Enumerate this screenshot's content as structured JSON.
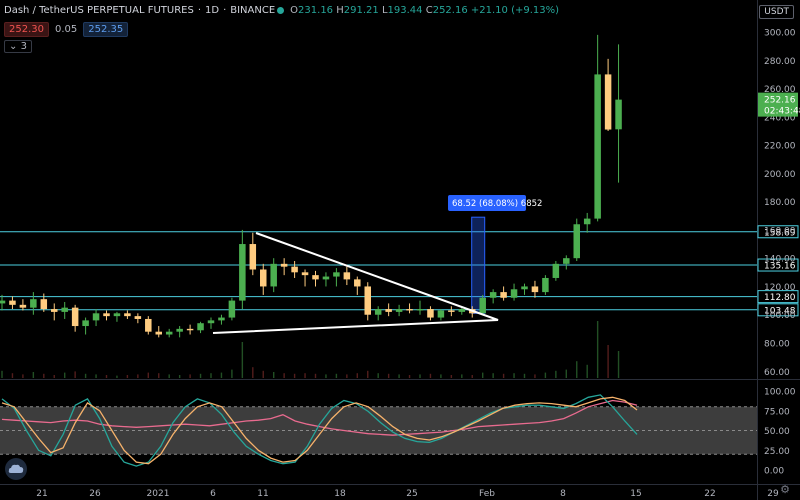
{
  "header": {
    "symbol": "Dash / TetherUS PERPETUAL FUTURES",
    "interval": "1D",
    "exchange": "BINANCE",
    "ohlc": {
      "open_label": "O",
      "open": "231.16",
      "high_label": "H",
      "high": "291.21",
      "low_label": "L",
      "low": "193.44",
      "close_label": "C",
      "close": "252.16",
      "change": "+21.10 (+9.13%)"
    },
    "sell_price": "252.30",
    "spread": "0.05",
    "buy_price": "252.35",
    "indicators_toggle": "3",
    "currency_button": "USDT"
  },
  "colors": {
    "up": "#26a69a",
    "down": "#ef5350",
    "candle_up_body": "#4caf50",
    "candle_down_body": "#ffcc80",
    "hline": "#4dd0e1",
    "triangle": "#ffffff",
    "range_box": "#2962ff",
    "stoch_k": "#f6b26b",
    "stoch_d": "#26a69a",
    "rsi": "#e96b8f"
  },
  "price_axis": {
    "ticks": [
      "300.00",
      "280.00",
      "260.00",
      "240.00",
      "220.00",
      "200.00",
      "180.00",
      "160.00",
      "140.00",
      "120.00",
      "100.00",
      "80.00",
      "60.00"
    ],
    "last_price_label": "252.16",
    "countdown_label": "02:43:48"
  },
  "time_axis": {
    "ticks": [
      "21",
      "26",
      "2021",
      "6",
      "11",
      "18",
      "25",
      "Feb",
      "8",
      "15",
      "22",
      "29"
    ]
  },
  "horizontal_levels": [
    "158.69",
    "135.16",
    "112.80",
    "103.48"
  ],
  "measure_tool": {
    "label": "68.52 (68.08%) 6852"
  },
  "oscillator_axis": {
    "ticks": [
      "100.00",
      "75.00",
      "50.00",
      "25.00",
      "0.00"
    ]
  },
  "chart_data": {
    "type": "candlestick",
    "date_ticks": [
      "21",
      "26",
      "2021",
      "6",
      "11",
      "18",
      "25",
      "Feb",
      "8",
      "15",
      "22",
      "29"
    ],
    "y_range": [
      60,
      305
    ],
    "candles": [
      {
        "o": 108,
        "h": 114,
        "l": 103,
        "c": 110
      },
      {
        "o": 110,
        "h": 113,
        "l": 104,
        "c": 107
      },
      {
        "o": 107,
        "h": 111,
        "l": 103,
        "c": 105
      },
      {
        "o": 105,
        "h": 116,
        "l": 100,
        "c": 111
      },
      {
        "o": 111,
        "h": 115,
        "l": 102,
        "c": 104
      },
      {
        "o": 104,
        "h": 108,
        "l": 96,
        "c": 102
      },
      {
        "o": 102,
        "h": 109,
        "l": 97,
        "c": 105
      },
      {
        "o": 105,
        "h": 107,
        "l": 88,
        "c": 92
      },
      {
        "o": 92,
        "h": 98,
        "l": 86,
        "c": 96
      },
      {
        "o": 96,
        "h": 104,
        "l": 92,
        "c": 101
      },
      {
        "o": 101,
        "h": 103,
        "l": 96,
        "c": 99
      },
      {
        "o": 99,
        "h": 102,
        "l": 95,
        "c": 101
      },
      {
        "o": 101,
        "h": 103,
        "l": 97,
        "c": 99
      },
      {
        "o": 99,
        "h": 101,
        "l": 94,
        "c": 97
      },
      {
        "o": 97,
        "h": 99,
        "l": 86,
        "c": 88
      },
      {
        "o": 88,
        "h": 92,
        "l": 84,
        "c": 86
      },
      {
        "o": 86,
        "h": 90,
        "l": 84,
        "c": 88
      },
      {
        "o": 88,
        "h": 92,
        "l": 84,
        "c": 90
      },
      {
        "o": 90,
        "h": 93,
        "l": 86,
        "c": 89
      },
      {
        "o": 89,
        "h": 95,
        "l": 87,
        "c": 94
      },
      {
        "o": 94,
        "h": 98,
        "l": 90,
        "c": 96
      },
      {
        "o": 96,
        "h": 100,
        "l": 93,
        "c": 98
      },
      {
        "o": 98,
        "h": 112,
        "l": 96,
        "c": 110
      },
      {
        "o": 110,
        "h": 160,
        "l": 104,
        "c": 150
      },
      {
        "o": 150,
        "h": 158,
        "l": 128,
        "c": 132
      },
      {
        "o": 132,
        "h": 136,
        "l": 114,
        "c": 120
      },
      {
        "o": 120,
        "h": 140,
        "l": 116,
        "c": 136
      },
      {
        "o": 136,
        "h": 140,
        "l": 128,
        "c": 134
      },
      {
        "o": 134,
        "h": 138,
        "l": 126,
        "c": 130
      },
      {
        "o": 130,
        "h": 132,
        "l": 120,
        "c": 128
      },
      {
        "o": 128,
        "h": 131,
        "l": 120,
        "c": 125
      },
      {
        "o": 125,
        "h": 130,
        "l": 120,
        "c": 127
      },
      {
        "o": 127,
        "h": 133,
        "l": 120,
        "c": 130
      },
      {
        "o": 130,
        "h": 134,
        "l": 121,
        "c": 125
      },
      {
        "o": 125,
        "h": 127,
        "l": 114,
        "c": 120
      },
      {
        "o": 120,
        "h": 123,
        "l": 96,
        "c": 100
      },
      {
        "o": 100,
        "h": 106,
        "l": 96,
        "c": 104
      },
      {
        "o": 104,
        "h": 108,
        "l": 99,
        "c": 102
      },
      {
        "o": 102,
        "h": 107,
        "l": 99,
        "c": 104
      },
      {
        "o": 104,
        "h": 108,
        "l": 101,
        "c": 103
      },
      {
        "o": 103,
        "h": 110,
        "l": 100,
        "c": 104
      },
      {
        "o": 104,
        "h": 106,
        "l": 96,
        "c": 98
      },
      {
        "o": 98,
        "h": 104,
        "l": 96,
        "c": 103
      },
      {
        "o": 103,
        "h": 106,
        "l": 99,
        "c": 102
      },
      {
        "o": 102,
        "h": 106,
        "l": 100,
        "c": 104
      },
      {
        "o": 104,
        "h": 106,
        "l": 98,
        "c": 101
      },
      {
        "o": 101,
        "h": 114,
        "l": 100,
        "c": 112
      },
      {
        "o": 112,
        "h": 118,
        "l": 108,
        "c": 116
      },
      {
        "o": 116,
        "h": 120,
        "l": 110,
        "c": 112
      },
      {
        "o": 112,
        "h": 122,
        "l": 110,
        "c": 118
      },
      {
        "o": 118,
        "h": 122,
        "l": 114,
        "c": 120
      },
      {
        "o": 120,
        "h": 124,
        "l": 112,
        "c": 116
      },
      {
        "o": 116,
        "h": 128,
        "l": 114,
        "c": 126
      },
      {
        "o": 126,
        "h": 138,
        "l": 124,
        "c": 136
      },
      {
        "o": 136,
        "h": 142,
        "l": 132,
        "c": 140
      },
      {
        "o": 140,
        "h": 168,
        "l": 138,
        "c": 164
      },
      {
        "o": 164,
        "h": 172,
        "l": 158,
        "c": 168
      },
      {
        "o": 168,
        "h": 298,
        "l": 166,
        "c": 270
      },
      {
        "o": 270,
        "h": 281,
        "l": 230,
        "c": 231
      },
      {
        "o": 231.16,
        "h": 291.21,
        "l": 193.44,
        "c": 252.16
      }
    ],
    "volume": [
      12,
      8,
      6,
      10,
      7,
      5,
      9,
      11,
      7,
      6,
      5,
      4,
      5,
      6,
      9,
      8,
      6,
      5,
      6,
      7,
      8,
      9,
      14,
      60,
      18,
      12,
      10,
      8,
      7,
      8,
      7,
      6,
      7,
      6,
      8,
      12,
      8,
      7,
      6,
      5,
      6,
      7,
      6,
      5,
      6,
      5,
      9,
      8,
      7,
      8,
      7,
      6,
      9,
      12,
      14,
      28,
      22,
      95,
      55,
      45
    ],
    "volume_range": [
      0,
      100
    ],
    "stoch_k": [
      85,
      80,
      60,
      40,
      22,
      28,
      60,
      85,
      75,
      50,
      25,
      10,
      8,
      20,
      45,
      65,
      80,
      85,
      80,
      60,
      40,
      25,
      15,
      10,
      12,
      25,
      45,
      65,
      80,
      85,
      80,
      68,
      55,
      45,
      40,
      38,
      42,
      48,
      55,
      62,
      70,
      78,
      82,
      84,
      85,
      84,
      82,
      80,
      85,
      90,
      92,
      88,
      76
    ],
    "stoch_d": [
      90,
      78,
      50,
      25,
      18,
      45,
      82,
      90,
      65,
      30,
      10,
      5,
      10,
      30,
      60,
      80,
      90,
      85,
      70,
      48,
      30,
      20,
      12,
      8,
      10,
      30,
      58,
      78,
      88,
      84,
      74,
      60,
      48,
      40,
      36,
      35,
      40,
      48,
      56,
      64,
      72,
      78,
      80,
      82,
      82,
      80,
      78,
      84,
      92,
      95,
      80,
      62,
      45
    ],
    "rsi": [
      64,
      63,
      62,
      61,
      60,
      62,
      63,
      62,
      58,
      56,
      55,
      54,
      55,
      56,
      57,
      58,
      57,
      56,
      58,
      60,
      62,
      63,
      65,
      70,
      62,
      58,
      55,
      52,
      50,
      48,
      46,
      45,
      44,
      45,
      46,
      47,
      48,
      50,
      52,
      55,
      56,
      57,
      58,
      59,
      60,
      62,
      65,
      72,
      80,
      84,
      88,
      86,
      82
    ],
    "oscillator_range": [
      0,
      100
    ]
  }
}
